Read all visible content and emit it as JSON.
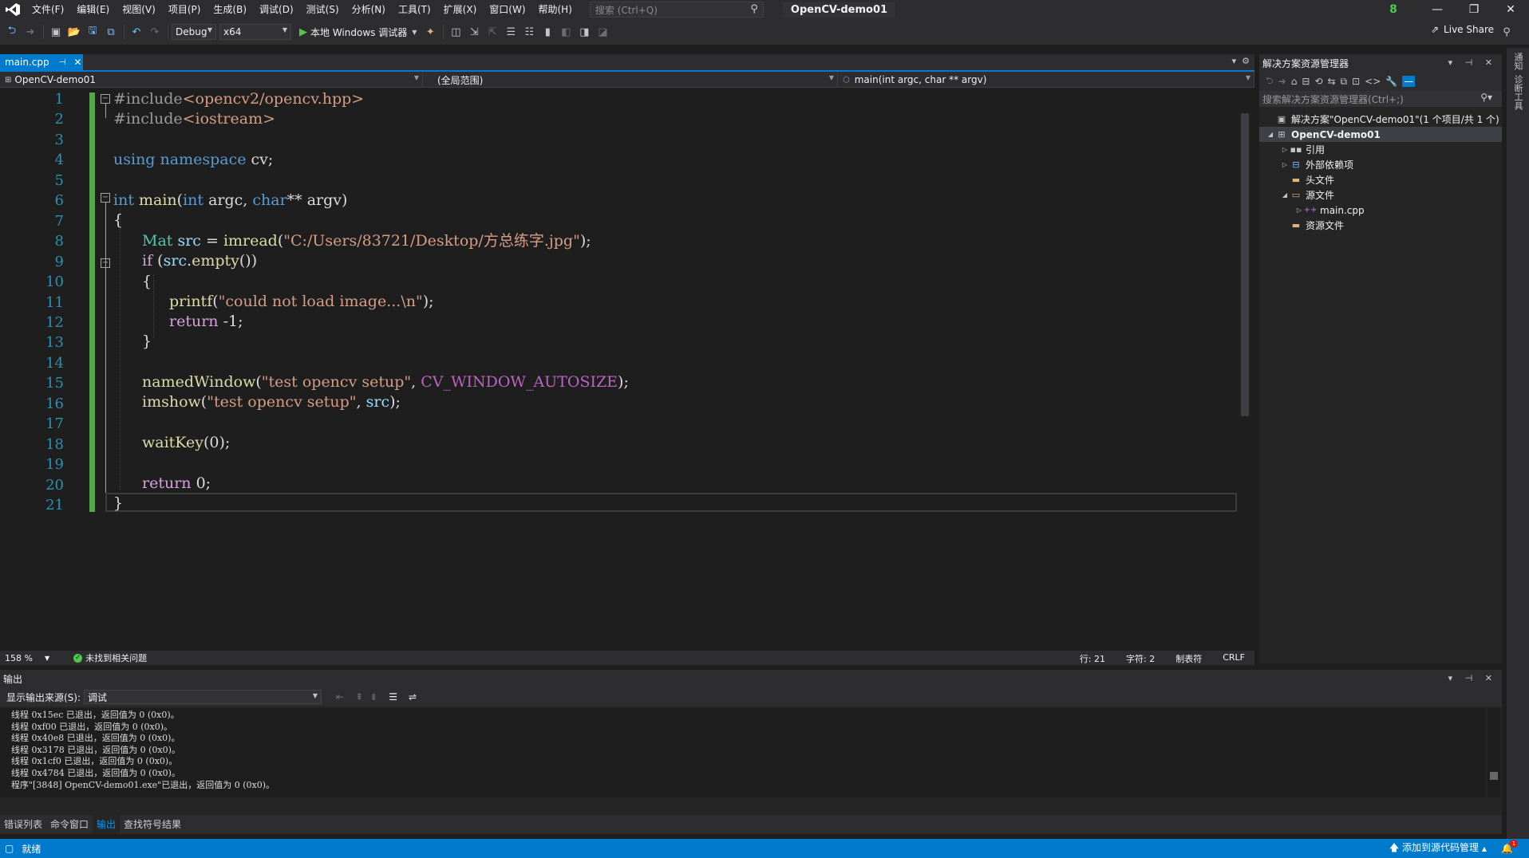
{
  "menu": {
    "items": [
      "文件(F)",
      "编辑(E)",
      "视图(V)",
      "项目(P)",
      "生成(B)",
      "调试(D)",
      "测试(S)",
      "分析(N)",
      "工具(T)",
      "扩展(X)",
      "窗口(W)",
      "帮助(H)"
    ],
    "search_placeholder": "搜索 (Ctrl+Q)",
    "project_title": "OpenCV-demo01",
    "user_badge": "8"
  },
  "toolbar": {
    "config": "Debug",
    "platform": "x64",
    "run_label": "本地 Windows 调试器",
    "live_share": "Live Share"
  },
  "editor": {
    "tab_name": "main.cpp",
    "nav_project": "OpenCV-demo01",
    "nav_scope": "(全局范围)",
    "nav_function": "main(int argc, char ** argv)",
    "line_numbers": [
      "1",
      "2",
      "3",
      "4",
      "5",
      "6",
      "7",
      "8",
      "9",
      "10",
      "11",
      "12",
      "13",
      "14",
      "15",
      "16",
      "17",
      "18",
      "19",
      "20",
      "21"
    ],
    "zoom": "158 %",
    "issues": "未找到相关问题",
    "row": "行: 21",
    "col": "字符: 2",
    "tabs": "制表符",
    "eol": "CRLF"
  },
  "code": {
    "l1_pp": "#include",
    "l1_hdr": "<opencv2/opencv.hpp>",
    "l2_pp": "#include",
    "l2_hdr": "<iostream>",
    "l4_using": "using",
    "l4_namespace": "namespace",
    "l4_ns": " cv;",
    "l6_int": "int",
    "l6_main": " main",
    "l6_open": "(",
    "l6_int2": "int",
    "l6_argc": " argc, ",
    "l6_char": "char",
    "l6_rest": "** argv)",
    "l7": "{",
    "l8_type": "Mat",
    "l8_var": " src",
    "l8_eq": " = ",
    "l8_fn": "imread",
    "l8_open": "(",
    "l8_str": "\"C:/Users/83721/Desktop/方总练字.jpg\"",
    "l8_end": ");",
    "l9_if": "if",
    "l9_open": " (",
    "l9_var": "src",
    "l9_dot": ".",
    "l9_fn": "empty",
    "l9_end": "())",
    "l10": "{",
    "l11_fn": "printf",
    "l11_open": "(",
    "l11_str": "\"could not load image...\\n\"",
    "l11_end": ");",
    "l12_ret": "return",
    "l12_val": " -1;",
    "l13": "}",
    "l15_fn": "namedWindow",
    "l15_open": "(",
    "l15_str": "\"test opencv setup\"",
    "l15_comma": ", ",
    "l15_mac": "CV_WINDOW_AUTOSIZE",
    "l15_end": ");",
    "l16_fn": "imshow",
    "l16_open": "(",
    "l16_str": "\"test opencv setup\"",
    "l16_comma": ", ",
    "l16_var": "src",
    "l16_end": ");",
    "l18_fn": "waitKey",
    "l18_args": "(0);",
    "l20_ret": "return",
    "l20_val": " 0;",
    "l21": "}"
  },
  "solution_explorer": {
    "title": "解决方案资源管理器",
    "search_placeholder": "搜索解决方案资源管理器(Ctrl+;)",
    "solution_label": "解决方案\"OpenCV-demo01\"(1 个项目/共 1 个)",
    "project": "OpenCV-demo01",
    "items": [
      "引用",
      "外部依赖项",
      "头文件",
      "源文件",
      "main.cpp",
      "资源文件"
    ]
  },
  "side_strip": {
    "tabs": [
      "通知",
      "诊断工具"
    ]
  },
  "output": {
    "title": "输出",
    "source_label": "显示输出来源(S):",
    "source_value": "调试",
    "lines": [
      "线程 0x15ec 已退出，返回值为 0 (0x0)。",
      "线程 0xf00 已退出，返回值为 0 (0x0)。",
      "线程 0x40e8 已退出，返回值为 0 (0x0)。",
      "线程 0x3178 已退出，返回值为 0 (0x0)。",
      "线程 0x1cf0 已退出，返回值为 0 (0x0)。",
      "线程 0x4784 已退出，返回值为 0 (0x0)。",
      "程序\"[3848] OpenCV-demo01.exe\"已退出，返回值为 0 (0x0)。"
    ]
  },
  "bottom_tabs": [
    "错误列表",
    "命令窗口",
    "输出",
    "查找符号结果"
  ],
  "status": {
    "ready": "就绪",
    "source_control": "添加到源代码管理",
    "notifications": "1"
  },
  "colors": {
    "accent": "#007acc",
    "change_bar": "#57a64a"
  }
}
